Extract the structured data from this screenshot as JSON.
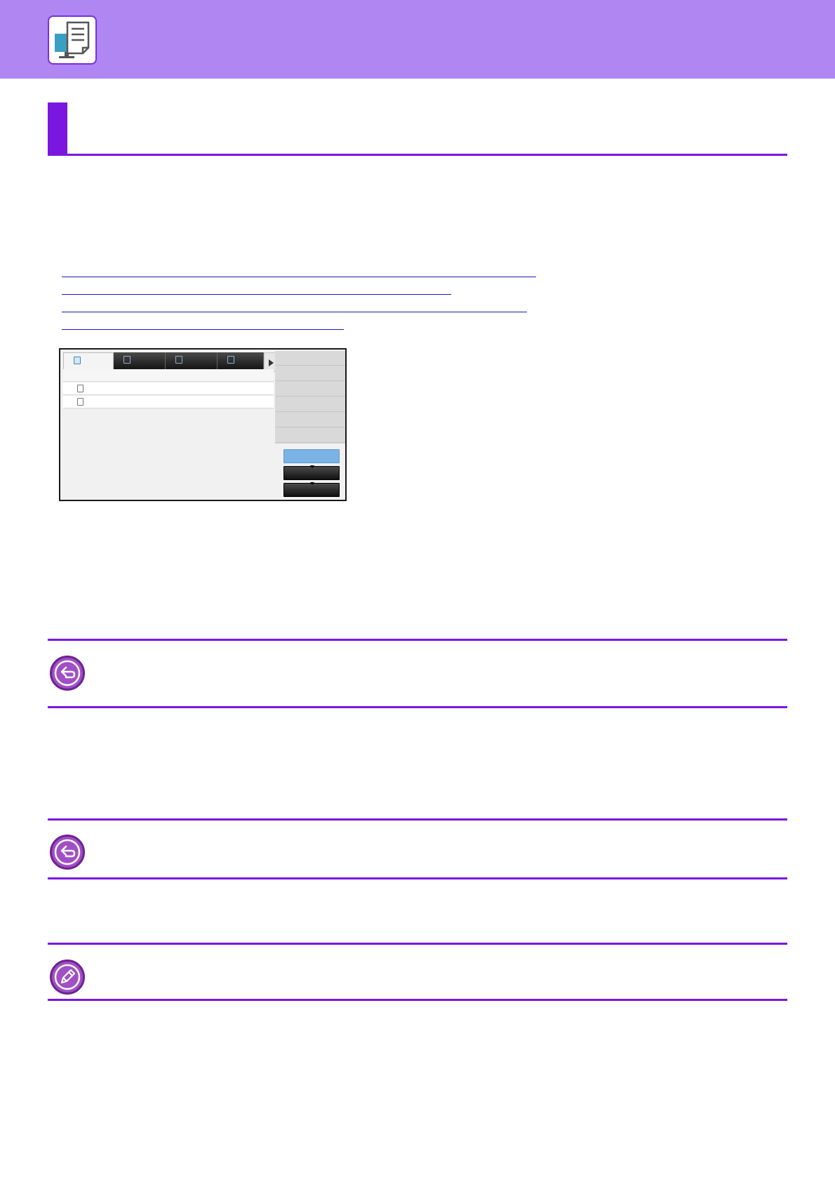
{
  "header": {
    "icon": "printer-monitor-icon"
  },
  "section": {
    "title": ""
  },
  "links": [
    {
      "text": ""
    },
    {
      "text": ""
    },
    {
      "text": ""
    },
    {
      "text": ""
    }
  ],
  "panel": {
    "tabs": [
      {
        "icon": "job-status-icon",
        "active": true
      },
      {
        "icon": "copy-icon",
        "active": false
      },
      {
        "icon": "print-icon",
        "active": false
      },
      {
        "icon": "scan-icon",
        "active": false
      }
    ],
    "rows": [
      {
        "icon": "document-icon"
      },
      {
        "icon": "document-icon"
      }
    ],
    "buttons": [
      {
        "style": "blue"
      },
      {
        "style": "dark"
      },
      {
        "style": "dark"
      }
    ]
  },
  "notes": [
    {
      "icon": "back-arrow-icon",
      "text": ""
    },
    {
      "icon": "back-arrow-icon",
      "text": ""
    },
    {
      "icon": "pencil-memo-icon",
      "text": ""
    }
  ],
  "colors": {
    "header_band": "#b086f3",
    "accent": "#7b16e0",
    "note_icon": "#a14fc5",
    "link": "#1b1bb5"
  }
}
